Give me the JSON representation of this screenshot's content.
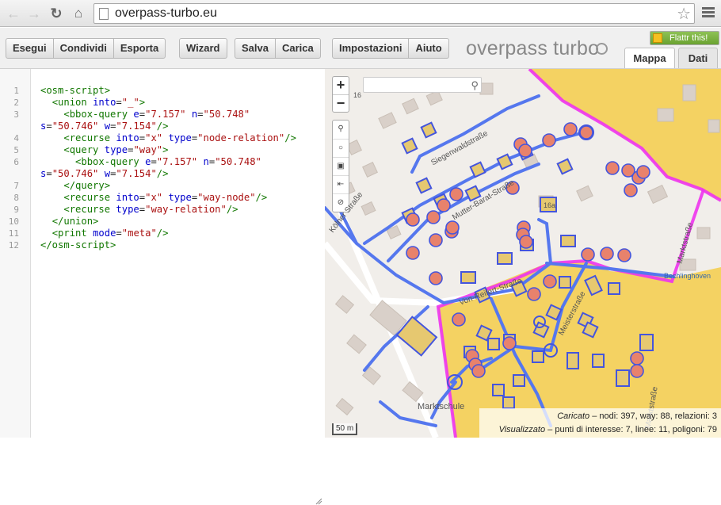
{
  "browser": {
    "url": "overpass-turbo.eu",
    "back_icon": "arrow-left-icon",
    "forward_icon": "arrow-right-icon",
    "reload_icon": "reload-icon",
    "home_icon": "home-icon"
  },
  "toolbar": {
    "groups": [
      [
        "Esegui",
        "Condividi",
        "Esporta"
      ],
      [
        "Wizard"
      ],
      [
        "Salva",
        "Carica"
      ],
      [
        "Impostazioni",
        "Aiuto"
      ]
    ],
    "brand": "overpass turbo",
    "flattr_label": "Flattr this!",
    "tabs": {
      "map": "Mappa",
      "data": "Dati"
    }
  },
  "editor": {
    "line_numbers": [
      "1",
      "2",
      "3",
      "4",
      "5",
      "6",
      "7",
      "8",
      "9",
      "10",
      "11",
      "12"
    ]
  },
  "map": {
    "house_number": "16a",
    "corner_number": "16",
    "streets": {
      "siegenwald": "Siegenwaldstraße",
      "mutter_barat": "Mutter-Barat-Straße",
      "von_reifert": "Von-Reifert-Straße",
      "markt_right": "Marktstraße",
      "markt_bottom": "Marktstraße",
      "meister": "Meisterstraße",
      "schule": "Marktschule",
      "bechlingh": "Bechlinghoven",
      "left": "Kölner Straße"
    },
    "scale": "50 m",
    "status": {
      "loaded_label": "Caricato",
      "loaded_values": "– nodi: 397, way: 88, relazioni: 3",
      "displayed_label": "Visualizzato",
      "displayed_values": "– punti di interesse: 7, linee: 11, poligoni: 79"
    }
  },
  "colors": {
    "way": "#5577ee",
    "node_fill": "#e8826c",
    "node_stroke": "#4455dd",
    "relation": "#ee33ee",
    "residential": "#f4d262",
    "building": "#d9d0c9"
  }
}
